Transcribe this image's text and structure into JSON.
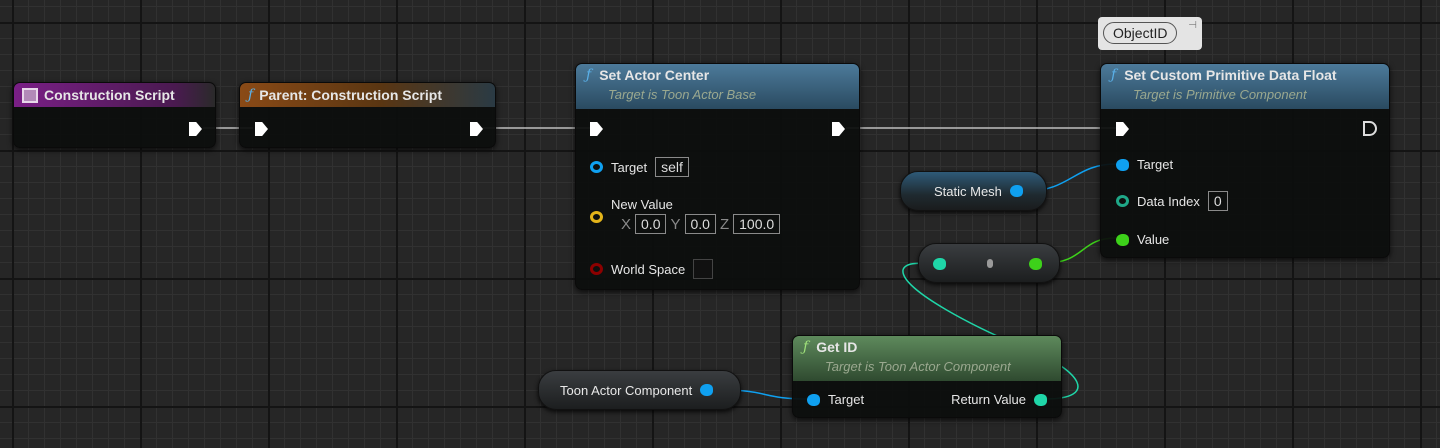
{
  "nodes": {
    "construction": {
      "title": "Construction Script"
    },
    "parent": {
      "title": "Parent: Construction Script"
    },
    "set_actor_center": {
      "title": "Set Actor Center",
      "subtitle": "Target is Toon Actor Base",
      "target_label": "Target",
      "target_value": "self",
      "new_value_label": "New Value",
      "x_label": "X",
      "x": "0.0",
      "y_label": "Y",
      "y": "0.0",
      "z_label": "Z",
      "z": "100.0",
      "world_space_label": "World Space"
    },
    "set_custom": {
      "title": "Set Custom Primitive Data Float",
      "subtitle": "Target is Primitive Component",
      "target_label": "Target",
      "data_index_label": "Data Index",
      "data_index": "0",
      "value_label": "Value",
      "comment": "ObjectID"
    },
    "static_mesh": {
      "label": "Static Mesh"
    },
    "get_id": {
      "title": "Get ID",
      "subtitle": "Target is Toon Actor Component",
      "target_label": "Target",
      "return_label": "Return Value"
    },
    "toon_actor_component": {
      "label": "Toon Actor Component"
    }
  },
  "colors": {
    "object": "#0fa0f0",
    "int": "#1fd6a8",
    "float": "#3dd11a",
    "vector": "#e3b41a",
    "bool": "#8c0000"
  }
}
